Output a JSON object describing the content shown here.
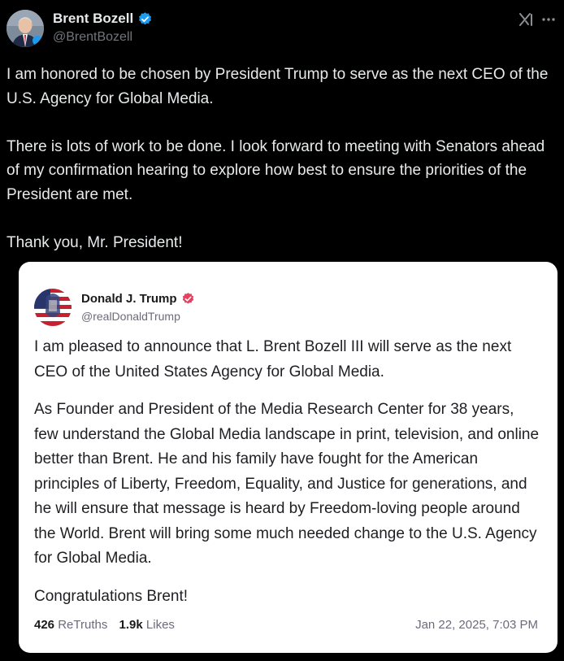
{
  "post": {
    "author_name": "Brent Bozell",
    "author_handle": "@BrentBozell",
    "paragraphs": [
      "I am honored to be chosen by President Trump to serve as the next CEO of the U.S. Agency for Global Media.",
      "There is lots of work to be done. I look forward to meeting with Senators ahead of my confirmation hearing to explore how best to ensure the priorities of the President are met.",
      "Thank you, Mr. President!"
    ]
  },
  "embed": {
    "author_name": "Donald J. Trump",
    "author_handle": "@realDonaldTrump",
    "paragraphs": [
      "I am pleased to announce that L. Brent Bozell III will serve as the next CEO of the United States Agency for Global Media.",
      "As Founder and President of the Media Research Center for 38 years, few understand the Global Media landscape in print, television, and online better than Brent. He and his family have fought for the American principles of Liberty, Freedom, Equality, and Justice for generations, and he will ensure that message is heard by Freedom-loving people around the World. Brent will bring some much needed change to the U.S. Agency for Global Media.",
      "Congratulations Brent!"
    ],
    "retruths_count": "426",
    "retruths_label": "ReTruths",
    "likes_count": "1.9k",
    "likes_label": "Likes",
    "timestamp": "Jan 22, 2025, 7:03 PM"
  },
  "icons": {
    "verified_badge": "verified-badge-icon",
    "truth_verified_badge": "verified-badge-icon",
    "grok": "grok-icon",
    "more": "more-options-icon"
  },
  "colors": {
    "background": "#000000",
    "text_primary": "#e7e9ea",
    "text_secondary": "#71767b",
    "x_verified": "#1d9bf0",
    "truth_verified": "#e8405e",
    "card_background": "#ffffff"
  }
}
